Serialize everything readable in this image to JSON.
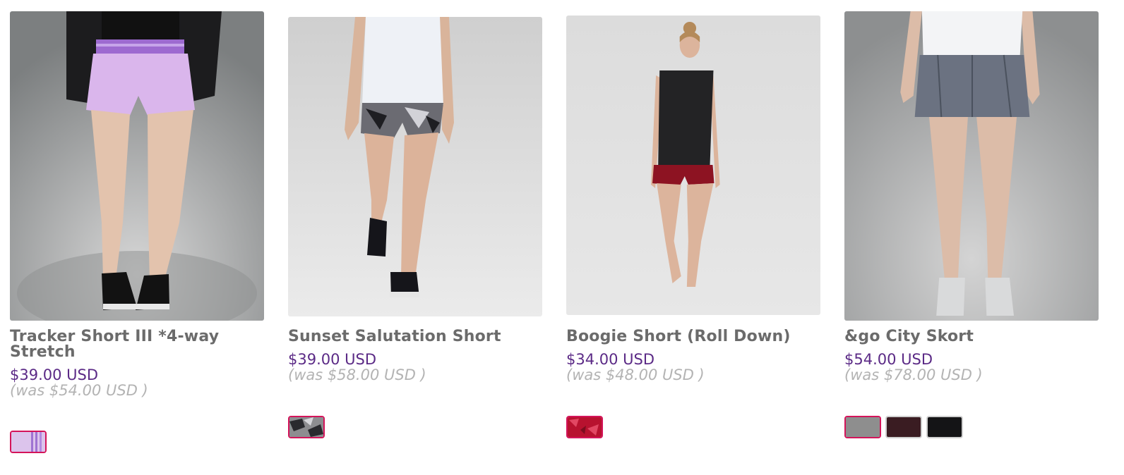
{
  "products": [
    {
      "name": "Tracker Short III *4-way Stretch",
      "price": "$39.00 USD",
      "was": "(was $54.00 USD )",
      "image": "product-photo-tracker-short",
      "swatches": [
        {
          "color": "#d8bfe6",
          "selected": true,
          "pattern": "lavender-stripe"
        }
      ]
    },
    {
      "name": "Sunset Salutation Short",
      "price": "$39.00 USD",
      "was": "(was $58.00 USD )",
      "image": "product-photo-sunset-salutation-short",
      "swatches": [
        {
          "color": "#8a8a8a",
          "selected": true,
          "pattern": "grey-print"
        }
      ]
    },
    {
      "name": "Boogie Short (Roll Down)",
      "price": "$34.00 USD",
      "was": "(was $48.00 USD )",
      "image": "product-photo-boogie-short",
      "swatches": [
        {
          "color": "#c2183a",
          "selected": true,
          "pattern": "red-print"
        }
      ]
    },
    {
      "name": "&go City Skort",
      "price": "$54.00 USD",
      "was": "(was $78.00 USD )",
      "image": "product-photo-go-city-skort",
      "swatches": [
        {
          "color": "#8e8e8e",
          "selected": true,
          "pattern": "heather-grey"
        },
        {
          "color": "#3a1c22",
          "selected": false,
          "pattern": "dark-plum"
        },
        {
          "color": "#141416",
          "selected": false,
          "pattern": "black"
        }
      ]
    }
  ],
  "colors": {
    "name_text": "#6b6b6b",
    "price_text": "#5b2a86",
    "was_text": "#b3b3b3",
    "selected_swatch_border": "#d4145a"
  }
}
